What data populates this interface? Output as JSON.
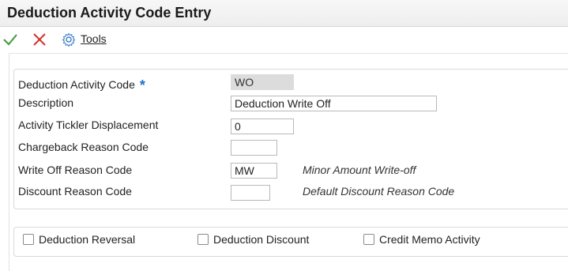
{
  "window": {
    "title": "Deduction Activity Code Entry"
  },
  "toolbar": {
    "ok_icon": "check-icon",
    "cancel_icon": "close-icon",
    "tools_icon": "gear-icon",
    "tools_label": "Tools"
  },
  "form": {
    "activity_code": {
      "label": "Deduction Activity Code",
      "required_mark": "*",
      "value": "WO"
    },
    "description": {
      "label": "Description",
      "value": "Deduction Write Off"
    },
    "tickler": {
      "label": "Activity Tickler Displacement",
      "value": "0"
    },
    "chargeback": {
      "label": "Chargeback Reason Code",
      "value": ""
    },
    "writeoff": {
      "label": "Write Off Reason Code",
      "value": "MW",
      "description": "Minor Amount Write-off"
    },
    "discount": {
      "label": "Discount Reason Code",
      "value": "",
      "description": "Default Discount Reason Code"
    }
  },
  "options": {
    "reversal": {
      "label": "Deduction Reversal",
      "checked": false
    },
    "deduction_discount": {
      "label": "Deduction Discount",
      "checked": false
    },
    "credit_memo": {
      "label": "Credit Memo Activity",
      "checked": false
    }
  },
  "colors": {
    "ok": "#3a9a3a",
    "cancel": "#d9302c",
    "required": "#1e6fc9",
    "tools": "#3b7fc4"
  }
}
